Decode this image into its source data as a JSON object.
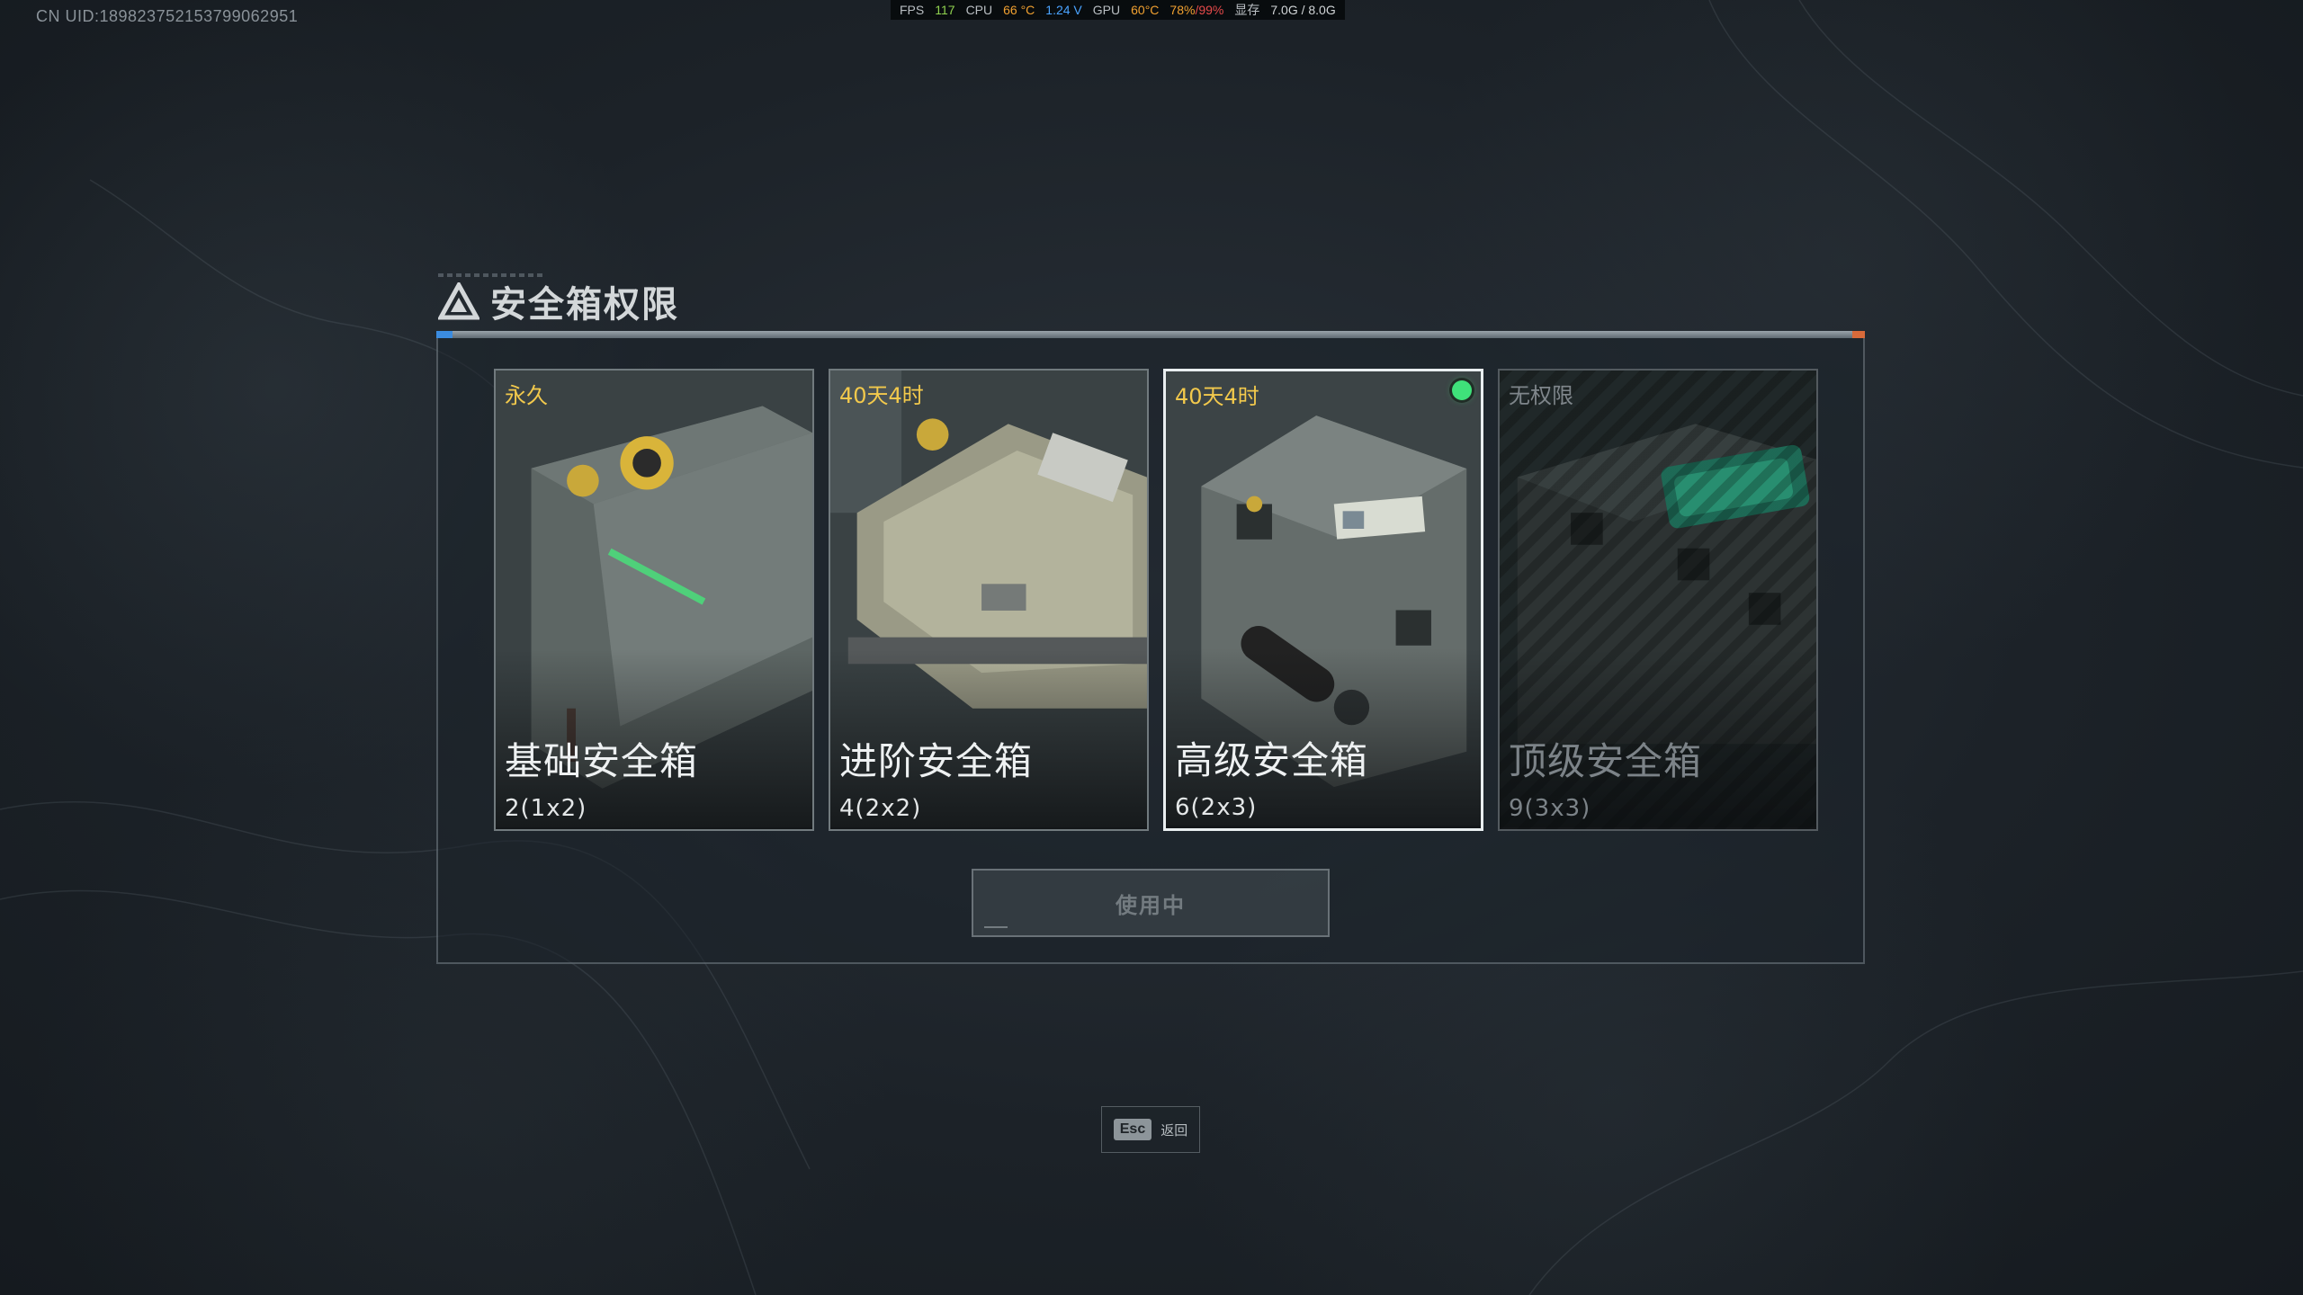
{
  "uid_label": "CN UID:1898237521537990629​51",
  "perf": {
    "fps_label": "FPS",
    "fps_value": "117",
    "cpu_label": "CPU",
    "cpu_temp": "66 °C",
    "cpu_voltage": "1.24 V",
    "gpu_label": "GPU",
    "gpu_temp": "60°C",
    "gpu_usage_a": "78%",
    "gpu_usage_b": "/99%",
    "vram_label": "显存",
    "vram_value": "7.0G / 8.0G"
  },
  "dialog": {
    "title": "安全箱权限",
    "cards": [
      {
        "duration": "永久",
        "name": "基础安全箱",
        "size": "2(1x2)",
        "state": "available"
      },
      {
        "duration": "40天4时",
        "name": "进阶安全箱",
        "size": "4(2x2)",
        "state": "available"
      },
      {
        "duration": "40天4时",
        "name": "高级安全箱",
        "size": "6(2x3)",
        "state": "selected"
      },
      {
        "duration": "无权限",
        "name": "顶级安全箱",
        "size": "9(3x3)",
        "state": "locked"
      }
    ],
    "use_button_label": "使用中"
  },
  "footer": {
    "esc_key": "Esc",
    "esc_label": "返回"
  },
  "colors": {
    "duration_gold": "#f2c94c",
    "active_green": "#3fe17a",
    "accent_blue": "#3b8ce0",
    "accent_orange": "#d86a3a"
  }
}
